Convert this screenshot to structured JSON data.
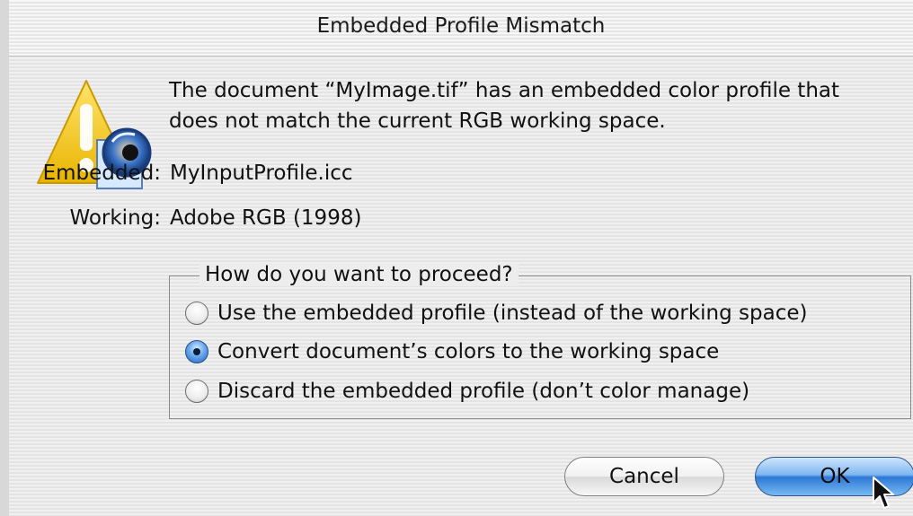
{
  "window": {
    "title": "Embedded Profile Mismatch"
  },
  "message": {
    "line1": "The document “MyImage.tif” has an embedded color profile that",
    "line2": "does not match the current RGB working space."
  },
  "profiles": {
    "embedded_label": "Embedded:",
    "embedded_value": "MyInputProfile.icc",
    "working_label": "Working:",
    "working_value": "Adobe RGB (1998)"
  },
  "options": {
    "legend": "How do you want to proceed?",
    "items": [
      {
        "label": "Use the embedded profile (instead of the working space)",
        "selected": false
      },
      {
        "label": "Convert document’s colors to the working space",
        "selected": true
      },
      {
        "label": "Discard the embedded profile (don’t color manage)",
        "selected": false
      }
    ]
  },
  "buttons": {
    "cancel": "Cancel",
    "ok": "OK"
  },
  "icons": {
    "warning": "warning-icon",
    "colorsync": "colorsync-icon",
    "cursor": "mouse-pointer-icon"
  },
  "colors": {
    "accent": "#2c78d6",
    "warning_yellow": "#f3c51a"
  }
}
